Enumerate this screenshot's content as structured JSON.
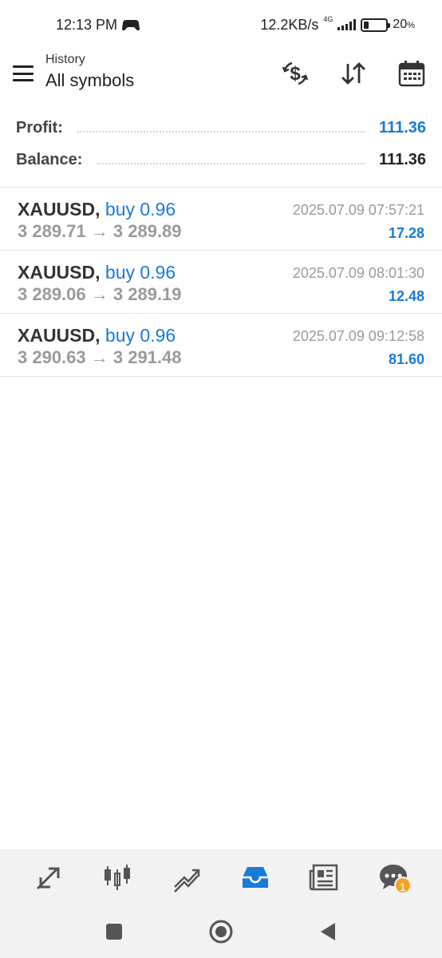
{
  "status_bar": {
    "time": "12:13 PM",
    "net_speed": "12.2KB/s",
    "network": "4G",
    "battery_percent": "20",
    "battery_unit": "%",
    "battery_level": 0.2
  },
  "header": {
    "subtitle": "History",
    "title": "All symbols",
    "icons": [
      "menu-icon",
      "dollar-exchange-icon",
      "sort-icon",
      "calendar-icon"
    ]
  },
  "summary": {
    "profit_label": "Profit:",
    "profit_value": "111.36",
    "balance_label": "Balance:",
    "balance_value": "111.36"
  },
  "deals": [
    {
      "symbol": "XAUUSD,",
      "direction": "buy 0.96",
      "time": "2025.07.09 07:57:21",
      "price_open": "3 289.71",
      "arrow": "→",
      "price_close": "3 289.89",
      "profit": "17.28"
    },
    {
      "symbol": "XAUUSD,",
      "direction": "buy 0.96",
      "time": "2025.07.09 08:01:30",
      "price_open": "3 289.06",
      "arrow": "→",
      "price_close": "3 289.19",
      "profit": "12.48"
    },
    {
      "symbol": "XAUUSD,",
      "direction": "buy 0.96",
      "time": "2025.07.09 09:12:58",
      "price_open": "3 290.63",
      "arrow": "→",
      "price_close": "3 291.48",
      "profit": "81.60"
    }
  ],
  "bottom_nav": {
    "items": [
      "quotes-icon",
      "chart-icon",
      "trade-icon",
      "history-icon",
      "news-icon",
      "chat-icon"
    ],
    "active": "history-icon",
    "chat_badge": "1"
  },
  "colors": {
    "accent": "#1a7ad8",
    "badge": "#f2a32a",
    "muted": "#9a9a9a"
  }
}
